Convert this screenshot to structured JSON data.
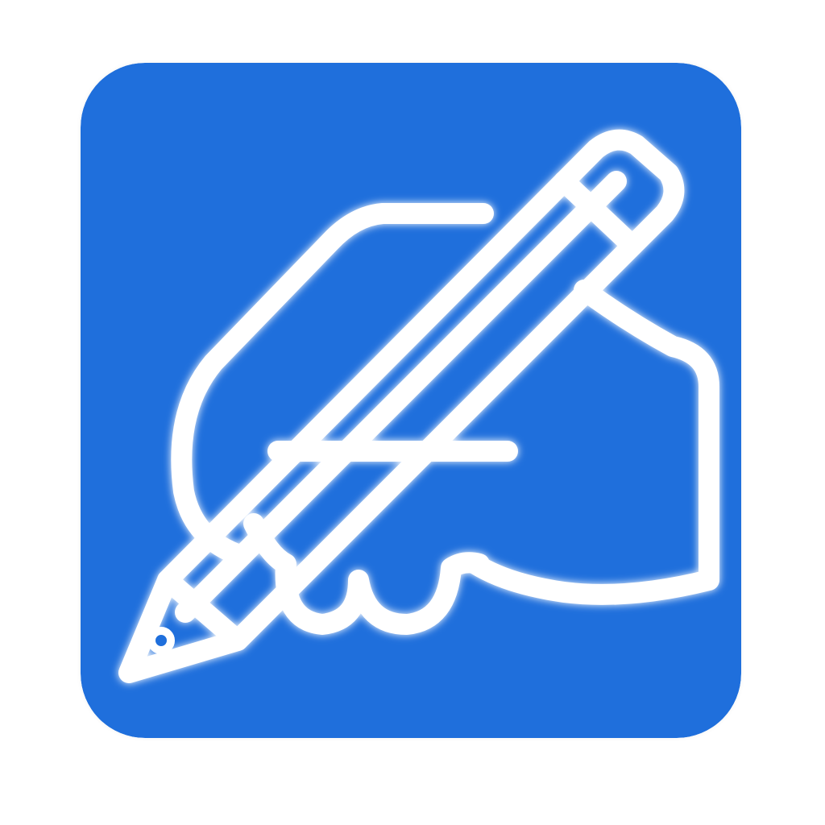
{
  "app_icon": {
    "icon": "handwriting-pencil-icon",
    "colors": {
      "background": "#1f6fdc",
      "stroke": "#ffffff",
      "glow": "#b9e3ff",
      "page": "#ffffff"
    }
  }
}
